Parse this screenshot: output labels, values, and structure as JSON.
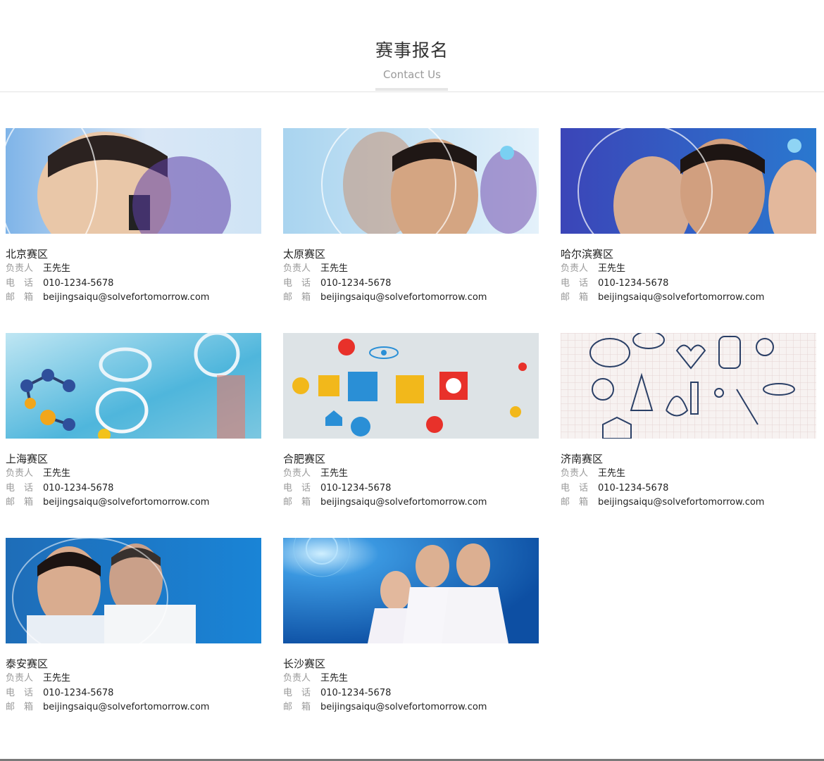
{
  "header": {
    "title": "赛事报名",
    "subtitle": "Contact Us"
  },
  "labels": {
    "person": "负责人",
    "phone": "电　话",
    "email": "邮　箱"
  },
  "regions": [
    {
      "name": "北京赛区",
      "person": "王先生",
      "phone": "010-1234-5678",
      "email": "beijingsaiqu@solvefortomorrow.com",
      "image": "girl-microscope-photo"
    },
    {
      "name": "太原赛区",
      "person": "王先生",
      "phone": "010-1234-5678",
      "email": "beijingsaiqu@solvefortomorrow.com",
      "image": "young-man-photo"
    },
    {
      "name": "哈尔滨赛区",
      "person": "王先生",
      "phone": "010-1234-5678",
      "email": "beijingsaiqu@solvefortomorrow.com",
      "image": "students-group-photo"
    },
    {
      "name": "上海赛区",
      "person": "王先生",
      "phone": "010-1234-5678",
      "email": "beijingsaiqu@solvefortomorrow.com",
      "image": "molecule-labware-photo"
    },
    {
      "name": "合肥赛区",
      "person": "王先生",
      "phone": "010-1234-5678",
      "email": "beijingsaiqu@solvefortomorrow.com",
      "image": "flat-science-icons"
    },
    {
      "name": "济南赛区",
      "person": "王先生",
      "phone": "010-1234-5678",
      "email": "beijingsaiqu@solvefortomorrow.com",
      "image": "science-doodles"
    },
    {
      "name": "泰安赛区",
      "person": "王先生",
      "phone": "010-1234-5678",
      "email": "beijingsaiqu@solvefortomorrow.com",
      "image": "student-teacher-photo"
    },
    {
      "name": "长沙赛区",
      "person": "王先生",
      "phone": "010-1234-5678",
      "email": "beijingsaiqu@solvefortomorrow.com",
      "image": "students-pointing-photo"
    }
  ],
  "colors": {
    "accent_blue": "#1a7fd1",
    "muted_text": "#9a9a9a",
    "title_text": "#333333"
  }
}
